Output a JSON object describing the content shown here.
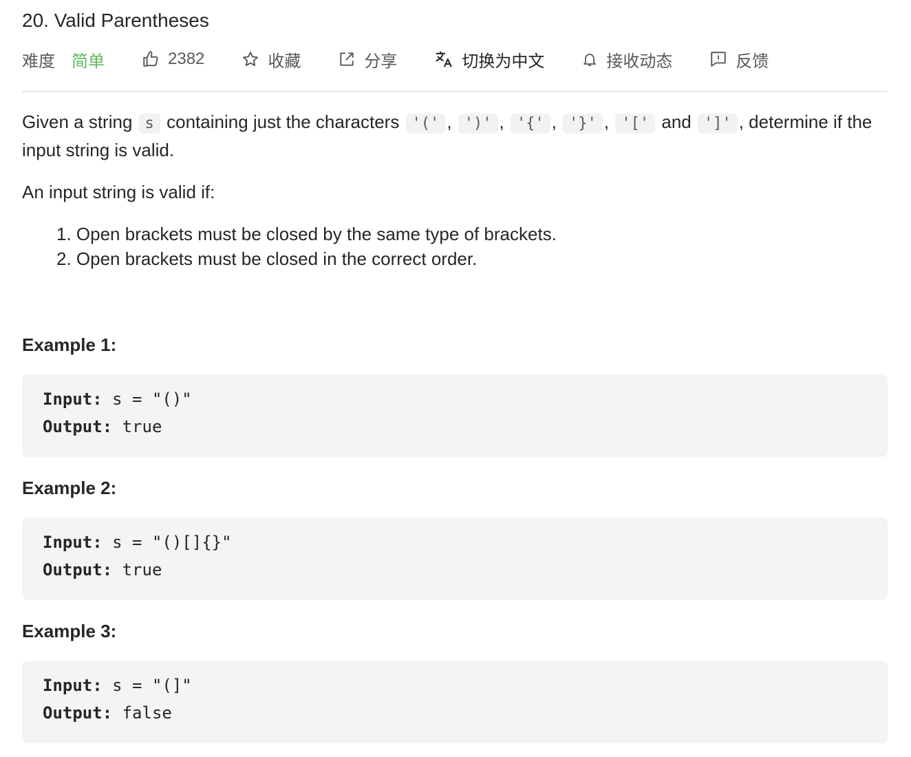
{
  "problem": {
    "title": "20. Valid Parentheses"
  },
  "toolbar": {
    "difficulty_label": "难度",
    "difficulty_value": "简单",
    "likes": "2382",
    "favorite_label": "收藏",
    "share_label": "分享",
    "translate_label": "切换为中文",
    "notify_label": "接收动态",
    "feedback_label": "反馈",
    "icons": {
      "like": "thumbs-up-icon",
      "favorite": "star-icon",
      "share": "share-icon",
      "translate": "translate-icon",
      "notify": "bell-icon",
      "feedback": "feedback-icon"
    },
    "colors": {
      "difficulty": "#5cb85c"
    }
  },
  "description": {
    "p1_a": "Given a string",
    "var_s": "s",
    "p1_b": "containing just the characters",
    "c1": "'('",
    "c2": "')'",
    "c3": "'{'",
    "c4": "'}'",
    "c5": "'['",
    "and": "and",
    "c6": "']'",
    "p1_c": ", determine if the input string is valid.",
    "valid_if": "An input string is valid if:",
    "rules": [
      "1. Open brackets must be closed by the same type of brackets.",
      "2. Open brackets must be closed in the correct order."
    ]
  },
  "examples": [
    {
      "heading": "Example 1:",
      "input_key": "Input:",
      "input_val": " s = \"()\"",
      "output_key": "Output:",
      "output_val": " true"
    },
    {
      "heading": "Example 2:",
      "input_key": "Input:",
      "input_val": " s = \"()[]{}\"",
      "output_key": "Output:",
      "output_val": " true"
    },
    {
      "heading": "Example 3:",
      "input_key": "Input:",
      "input_val": " s = \"(]\"",
      "output_key": "Output:",
      "output_val": " false"
    }
  ]
}
